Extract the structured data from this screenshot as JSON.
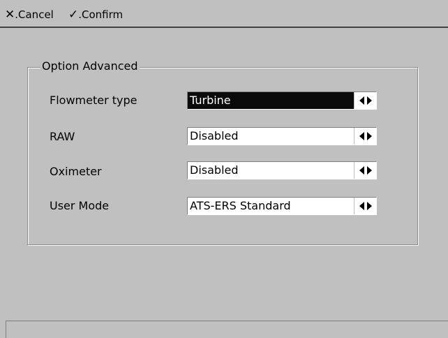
{
  "toolbar": {
    "cancel": {
      "glyph": "✕",
      "label": ".Cancel",
      "icon": "close-icon"
    },
    "confirm": {
      "glyph": "✓",
      "label": ".Confirm",
      "icon": "checkmark-icon"
    }
  },
  "group": {
    "title": "Option Advanced"
  },
  "rows": [
    {
      "label": "Flowmeter type",
      "value": "Turbine",
      "active": true
    },
    {
      "label": "RAW",
      "value": "Disabled",
      "active": false
    },
    {
      "label": "Oximeter",
      "value": "Disabled",
      "active": false
    },
    {
      "label": "User Mode",
      "value": "ATS-ERS Standard",
      "active": false
    }
  ],
  "statusbar": {
    "text": ""
  },
  "colors": {
    "window_bg": "#c0c0c0",
    "active_field_bg": "#0a0a0a",
    "active_field_text": "#ffffff",
    "field_bg": "#ffffff"
  }
}
